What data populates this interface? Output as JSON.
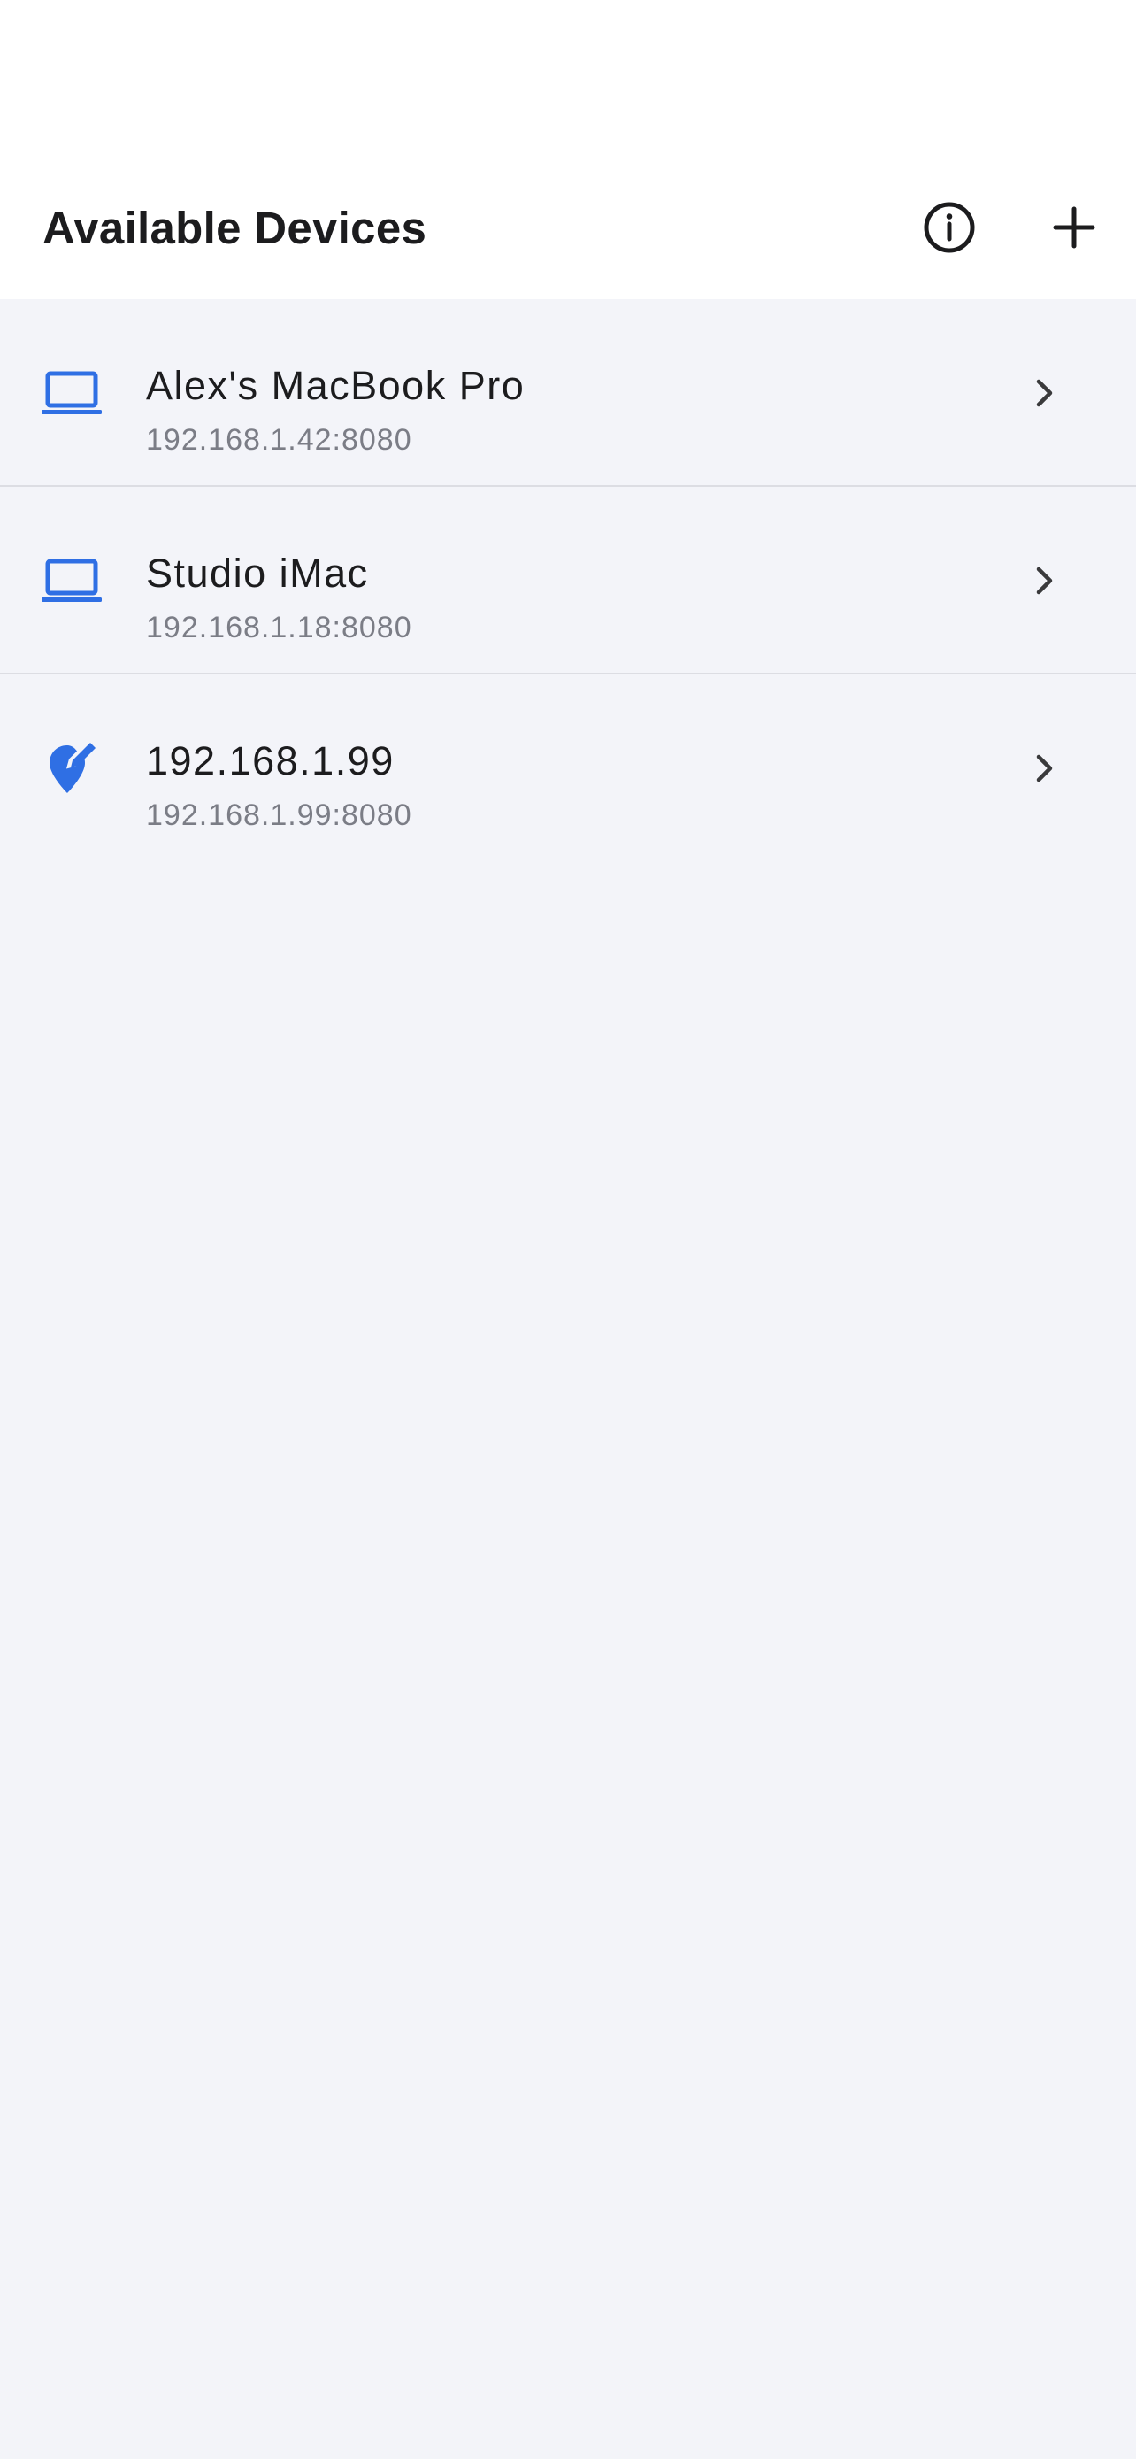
{
  "header": {
    "title": "Available Devices",
    "info_icon": "info-circle-icon",
    "add_icon": "plus-icon"
  },
  "colors": {
    "accent": "#2f6fe4",
    "text_primary": "#1c1c1e",
    "text_secondary": "#7b7d86",
    "background": "#f3f4f9",
    "header_background": "#ffffff",
    "divider": "#dcdde3"
  },
  "devices": [
    {
      "name": "Alex's MacBook Pro",
      "address": "192.168.1.42:8080",
      "icon": "laptop-icon"
    },
    {
      "name": "Studio iMac",
      "address": "192.168.1.18:8080",
      "icon": "laptop-icon"
    },
    {
      "name": "192.168.1.99",
      "address": "192.168.1.99:8080",
      "icon": "edit-location-icon"
    }
  ]
}
